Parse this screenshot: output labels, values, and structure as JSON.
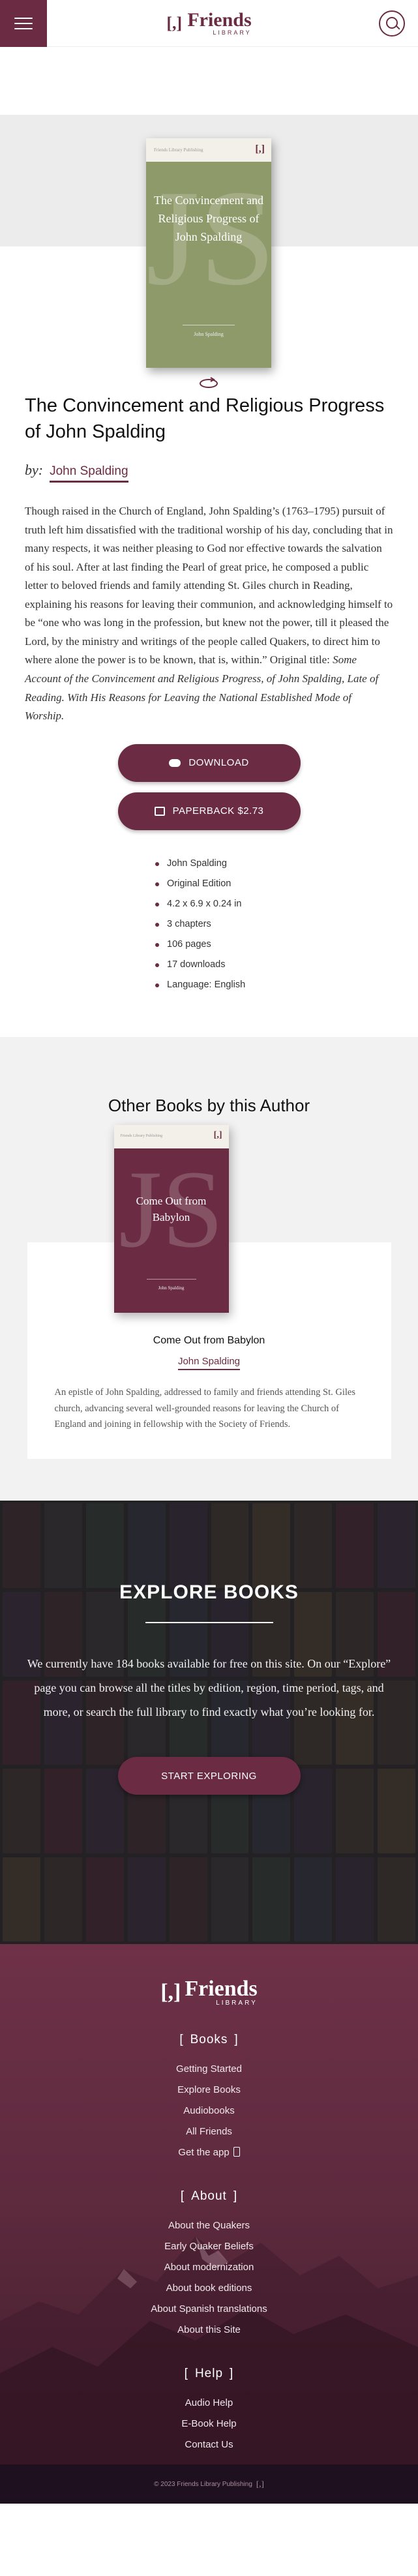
{
  "header": {
    "logo_mark": "[,]",
    "logo_name": "Friends",
    "logo_sub": "LIBRARY"
  },
  "book": {
    "cover_small_text": "Friends Library Publishing",
    "cover_mark": "[,]",
    "cover_monogram": "JS",
    "cover_title": "The Convincement and Religious Progress of John Spalding",
    "cover_author": "John Spalding",
    "title": "The Convincement and Religious Progress of John Spalding",
    "by_label": "by:",
    "author": "John Spalding",
    "description": "Though raised in the Church of England, John Spalding’s (1763–1795) pursuit of truth left him dissatisfied with the traditional worship of his day, concluding that in many respects, it was neither pleasing to God nor effective towards the salvation of his soul. After at last finding the Pearl of great price, he composed a public letter to beloved friends and family attending St. Giles church in Reading, explaining his reasons for leaving their communion, and acknowledging himself to be “one who was long in the profession, but knew not the power, till it pleased the Lord, by the ministry and writings of the people called Quakers, to direct him to where alone the power is to be known, that is, within.” Original title: ",
    "original_title": "Some Account of the Convincement and Religious Progress, of John Spalding, Late of Reading. With His Reasons for Leaving the National Established Mode of Worship."
  },
  "actions": {
    "download_label": "DOWNLOAD",
    "paperback_label": "PAPERBACK $2.73"
  },
  "meta": [
    "John Spalding",
    "Original Edition",
    "4.2 x 6.9 x 0.24 in",
    "3 chapters",
    "106 pages",
    "17 downloads",
    "Language: English"
  ],
  "other_books": {
    "heading": "Other Books by this Author",
    "card": {
      "cover_small_text": "Friends Library Publishing",
      "cover_mark": "[,]",
      "cover_monogram": "JS",
      "cover_title": "Come Out from Babylon",
      "cover_author": "John Spalding",
      "title": "Come Out from Babylon",
      "author": "John Spalding",
      "description": "An epistle of John Spalding, addressed to family and friends attending St. Giles church, advancing several well-grounded reasons for leaving the Church of England and joining in fellowship with the Society of Friends."
    }
  },
  "explore": {
    "heading": "EXPLORE BOOKS",
    "text": "We currently have 184 books available for free on this site. On our “Explore” page you can browse all the titles by edition, region, time period, tags, and more, or search the full library to find exactly what you’re looking for.",
    "button_label": "START EXPLORING"
  },
  "footer": {
    "logo_mark": "[,]",
    "logo_name": "Friends",
    "logo_sub": "LIBRARY",
    "sections": [
      {
        "title": "Books",
        "items": [
          "Getting Started",
          "Explore Books",
          "Audiobooks",
          "All Friends",
          "Get the app"
        ]
      },
      {
        "title": "About",
        "items": [
          "About the Quakers",
          "Early Quaker Beliefs",
          "About modernization",
          "About book editions",
          "About Spanish translations",
          "About this Site"
        ]
      },
      {
        "title": "Help",
        "items": [
          "Audio Help",
          "E-Book Help",
          "Contact Us"
        ]
      }
    ],
    "copyright": "© 2023 Friends Library Publishing",
    "copyright_mark": "[,]"
  },
  "colors": {
    "brand": "#6b2c43",
    "cover_green": "#8f9a6b",
    "footer_dark": "#1f1020"
  },
  "icons": [
    "menu-icon",
    "search-icon",
    "flip-cover-icon",
    "cloud-download-icon",
    "book-icon",
    "phone-icon"
  ]
}
